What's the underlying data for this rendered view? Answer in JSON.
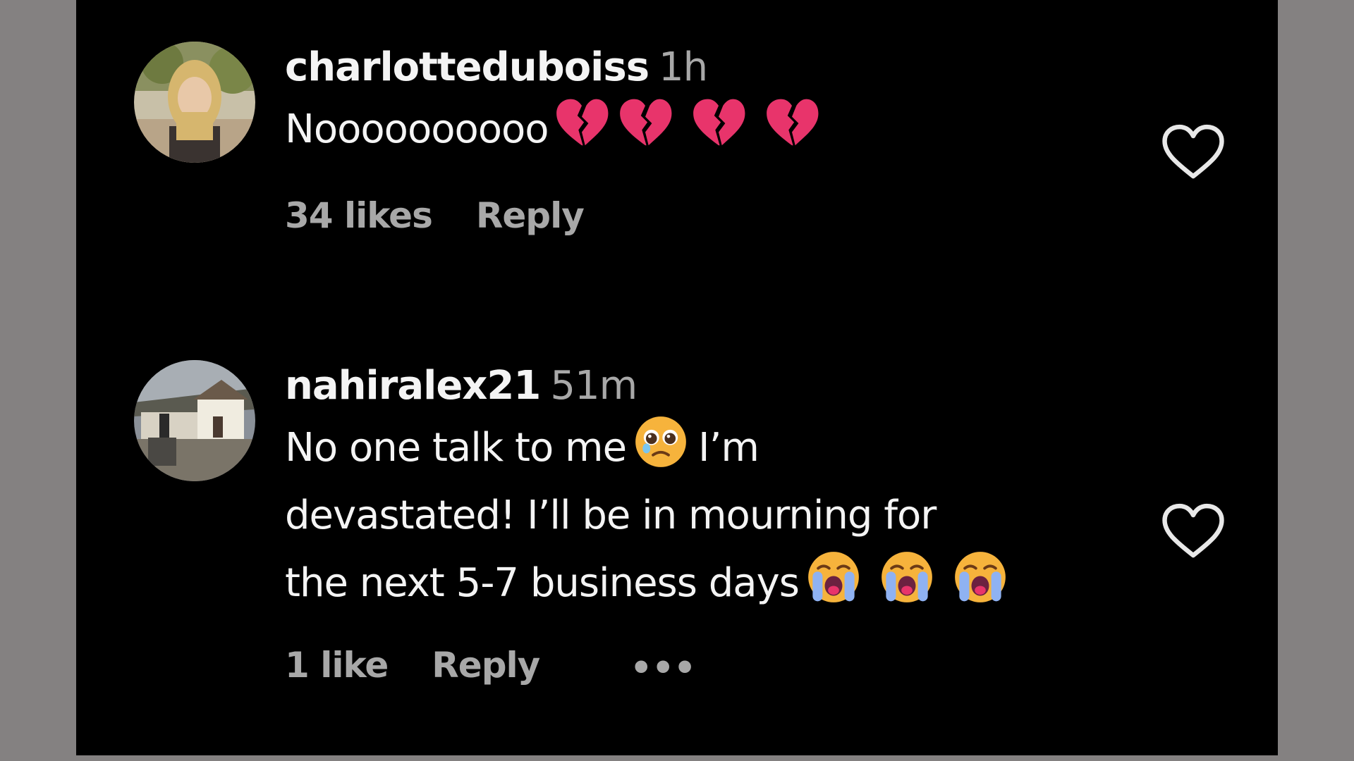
{
  "comments": [
    {
      "username": "charlotteduboiss",
      "time": "1h",
      "text_lines": [
        "Noooooooooo"
      ],
      "emojis": [
        "broken-heart-emoji",
        "broken-heart-emoji",
        "broken-heart-emoji",
        "broken-heart-emoji"
      ],
      "likes": "34 likes",
      "reply": "Reply"
    },
    {
      "username": "nahiralex21",
      "time": "51m",
      "text_lines": [
        "No one talk to me",
        "I’m",
        "devastated! I’ll be in mourning for",
        "the next 5-7 business days"
      ],
      "emojis": [
        "pleading-face-emoji",
        "loudly-crying-face-emoji",
        "loudly-crying-face-emoji",
        "loudly-crying-face-emoji"
      ],
      "likes": "1 like",
      "reply": "Reply",
      "more": "•••"
    }
  ],
  "colors": {
    "background": "#000000",
    "frame": "#848181",
    "primary_text": "#f4f4f4",
    "secondary_text": "#a8a8a8",
    "broken_heart": "#e8346b"
  },
  "icons": {
    "like": "heart-outline-icon",
    "more": "more-dots-icon"
  }
}
